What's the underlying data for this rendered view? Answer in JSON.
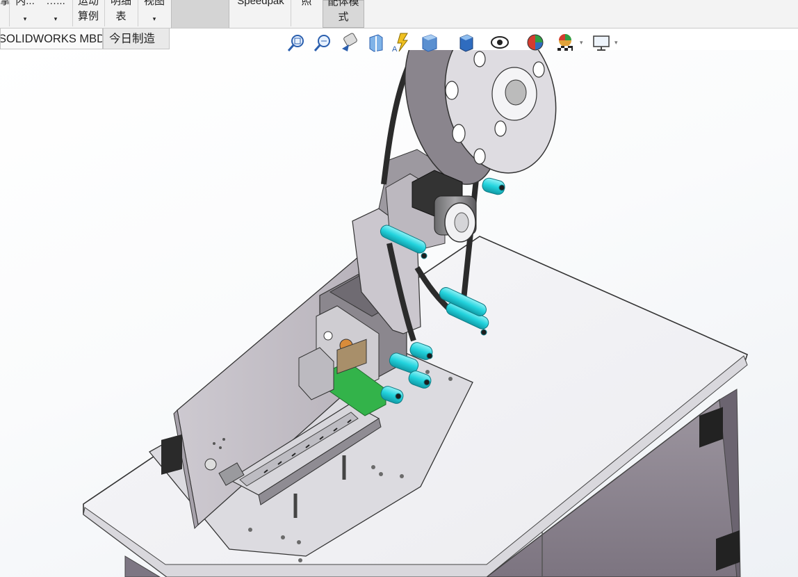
{
  "ribbon": {
    "items": [
      {
        "line1": "掌",
        "line2": ""
      },
      {
        "line1": "内...",
        "line2": "▾"
      },
      {
        "line1": "…...",
        "line2": "▾"
      },
      {
        "line1": "运动",
        "line2": "算例"
      },
      {
        "line1": "明细",
        "line2": "表"
      },
      {
        "line1": "视图",
        "line2": "▾"
      },
      {
        "line1": "",
        "line2": ""
      },
      {
        "line1": "Speedpak",
        "line2": ""
      },
      {
        "line1": "照",
        "line2": ""
      },
      {
        "line1": "配体模",
        "line2": "式"
      }
    ]
  },
  "tabs": [
    {
      "label": "SOLIDWORKS MBD"
    },
    {
      "label": "今日制造"
    }
  ],
  "heads_up_toolbar": {
    "icons": [
      "zoom-to-fit-icon",
      "zoom-to-area-icon",
      "previous-view-icon",
      "section-view-icon",
      "dynamic-annotation-icon",
      "view-orientation-icon",
      "display-style-icon",
      "hide-show-items-icon",
      "edit-appearance-icon",
      "apply-scene-icon",
      "view-settings-icon"
    ]
  },
  "colors": {
    "ribbon_bg": "#f3f3f3",
    "viewport_top": "#ffffff",
    "viewport_bottom": "#eef1f5",
    "part_grey": "#c9c5cc",
    "part_dark": "#555555",
    "roller_cyan": "#27d6e0",
    "pcb_green": "#33b34a"
  }
}
